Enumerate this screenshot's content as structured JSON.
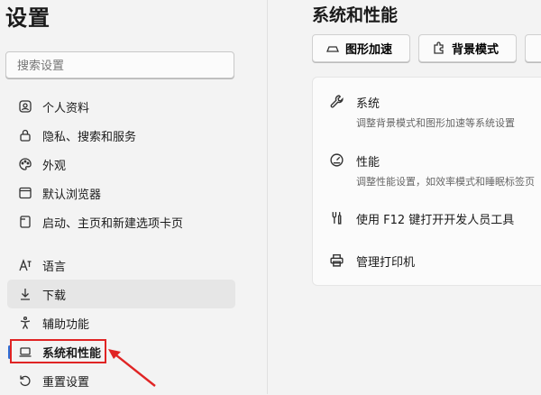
{
  "sidebar": {
    "title": "设置",
    "search_placeholder": "搜索设置",
    "items": [
      {
        "label": "个人资料"
      },
      {
        "label": "隐私、搜索和服务"
      },
      {
        "label": "外观"
      },
      {
        "label": "默认浏览器"
      },
      {
        "label": "启动、主页和新建选项卡页"
      },
      {
        "label": "语言"
      },
      {
        "label": "下载"
      },
      {
        "label": "辅助功能"
      },
      {
        "label": "系统和性能"
      },
      {
        "label": "重置设置"
      }
    ]
  },
  "main": {
    "title": "系统和性能",
    "buttons": [
      {
        "label": "图形加速",
        "icon": "gpu-icon"
      },
      {
        "label": "背景模式",
        "icon": "puzzle-icon"
      }
    ],
    "sections": [
      {
        "label": "系统",
        "desc": "调整背景模式和图形加速等系统设置",
        "icon": "wrench-icon"
      },
      {
        "label": "性能",
        "desc": "调整性能设置，如效率模式和睡眠标签页",
        "icon": "gauge-icon"
      },
      {
        "label": "使用 F12 键打开开发人员工具",
        "desc": "",
        "icon": "tools-icon"
      },
      {
        "label": "管理打印机",
        "desc": "",
        "icon": "printer-icon"
      }
    ]
  },
  "colors": {
    "accent": "#2f6fd6",
    "highlight": "#e02424"
  }
}
